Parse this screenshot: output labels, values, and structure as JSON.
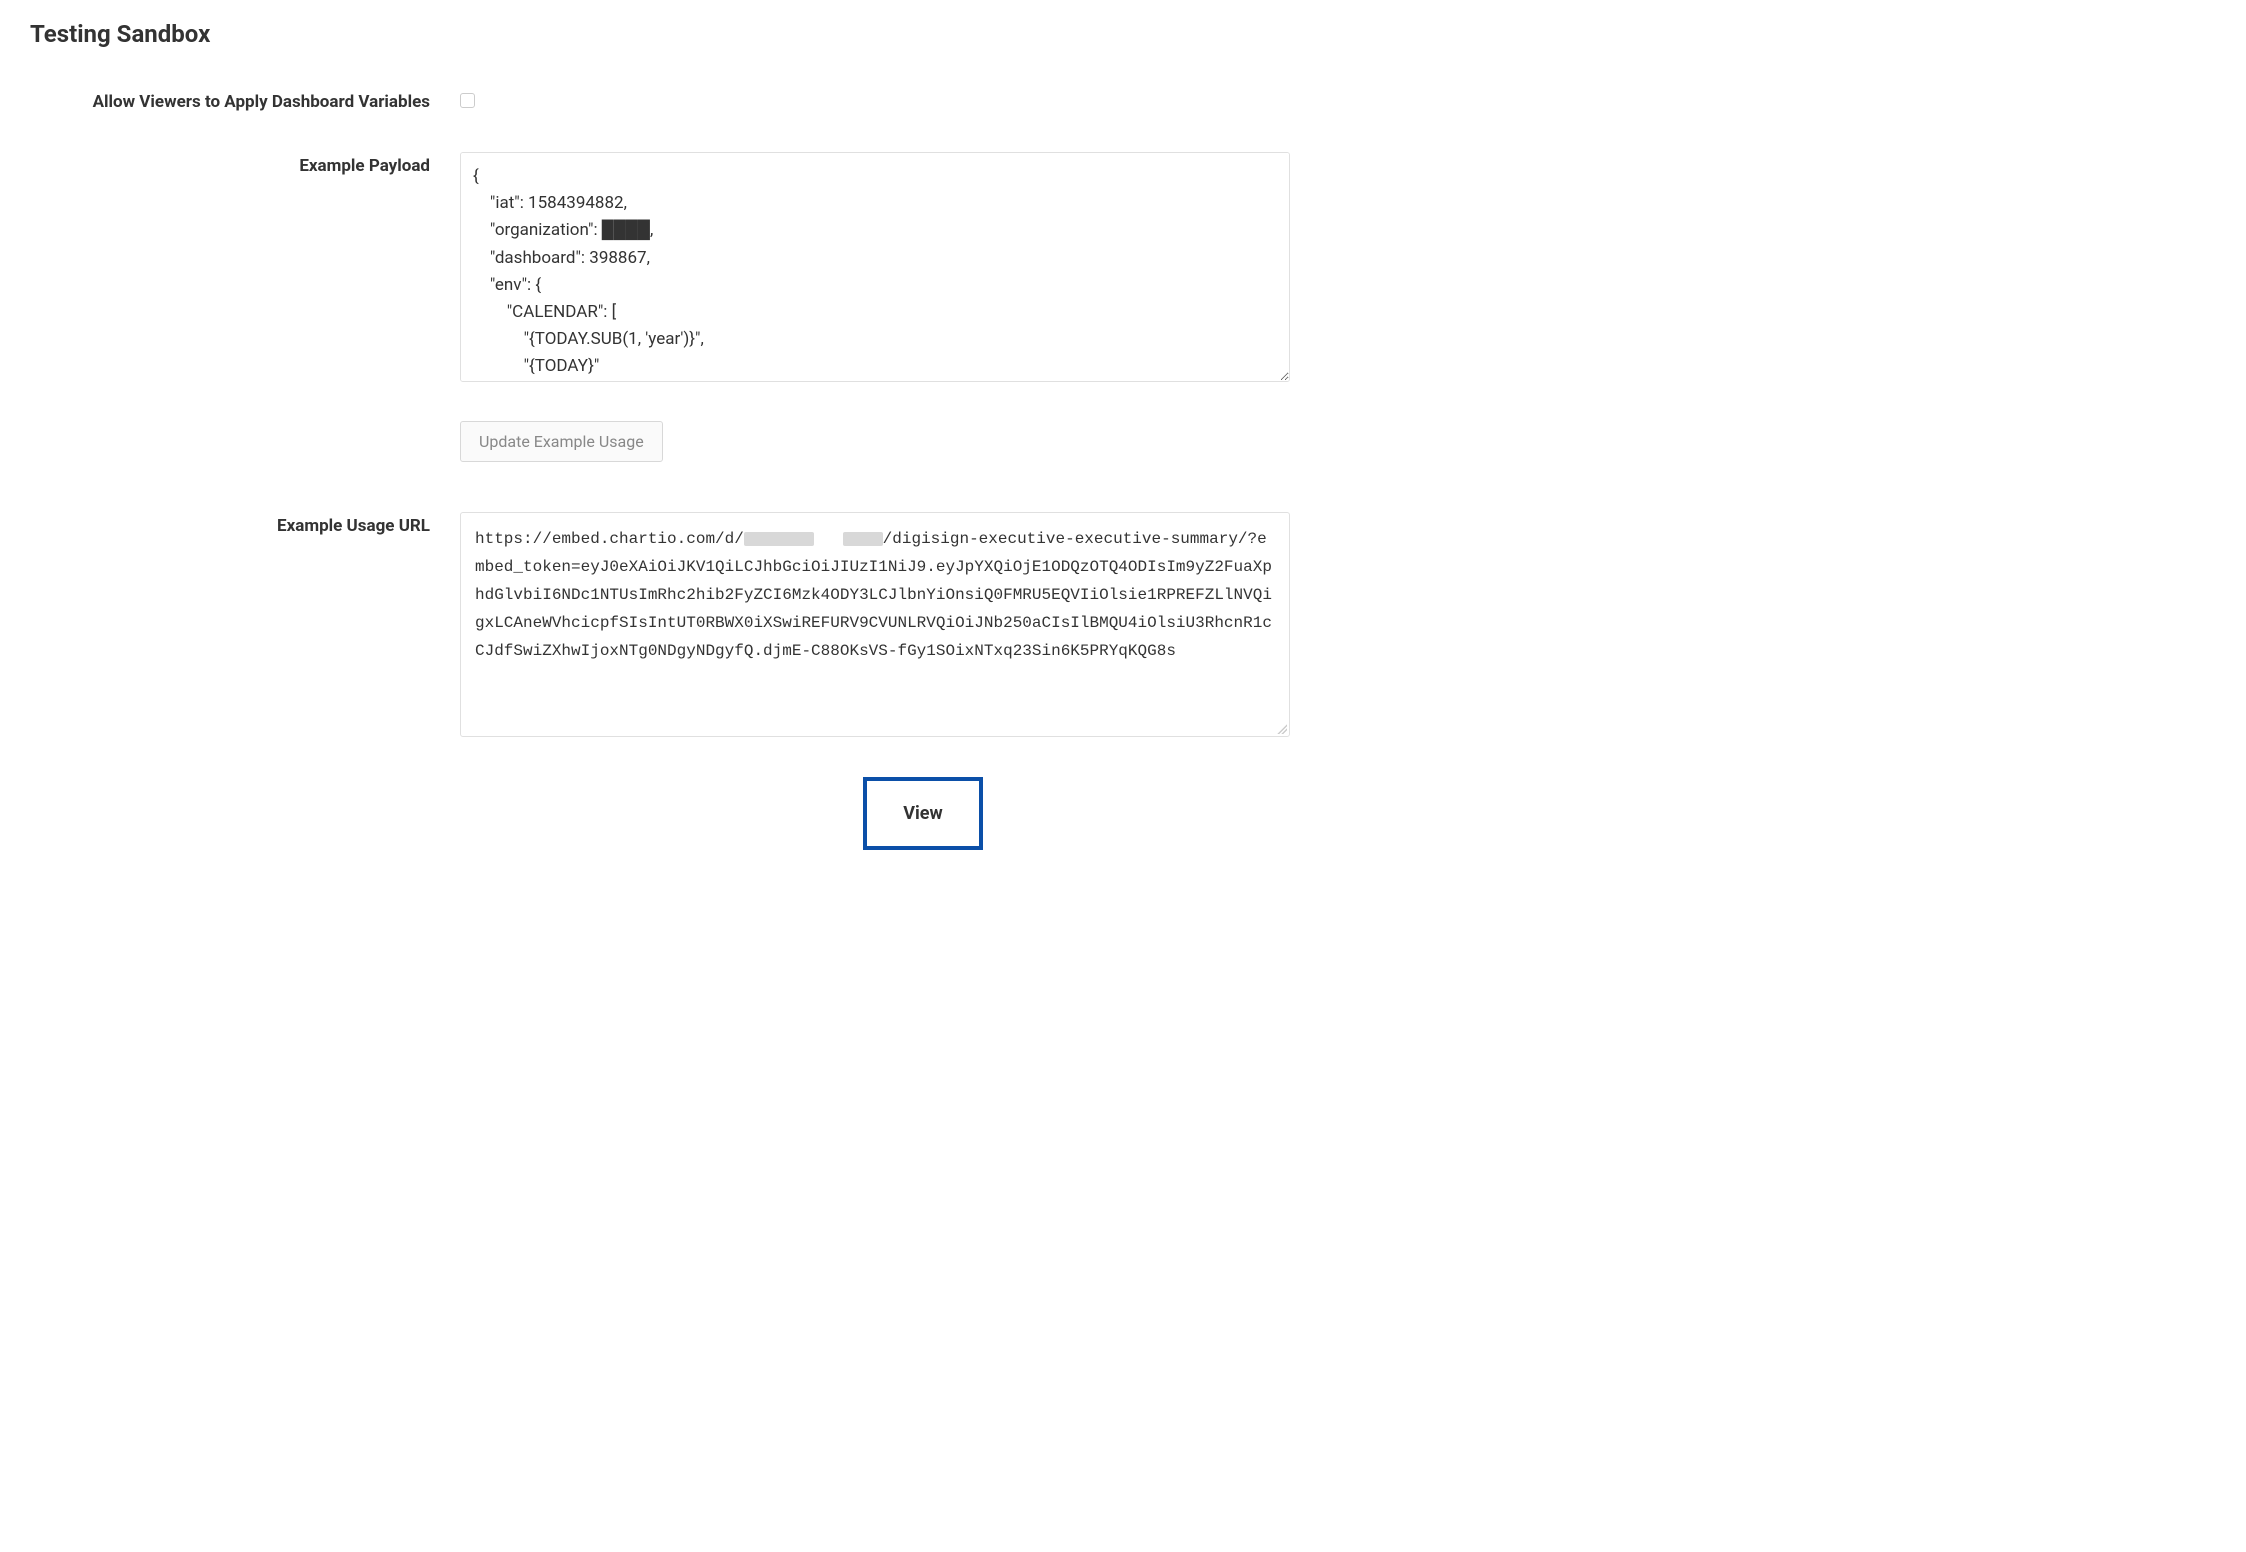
{
  "section_title": "Testing Sandbox",
  "allow_viewers_label": "Allow Viewers to Apply Dashboard Variables",
  "allow_viewers_checked": false,
  "example_payload_label": "Example Payload",
  "example_payload_value": "{\n    \"iat\": 1584394882,\n    \"organization\": ████,\n    \"dashboard\": 398867,\n    \"env\": {\n        \"CALENDAR\": [\n            \"{TODAY.SUB(1, 'year')}\",\n            \"{TODAY}\"",
  "update_example_usage_label": "Update Example Usage",
  "example_usage_url_label": "Example Usage URL",
  "example_usage_url": {
    "prefix": "https://embed.chartio.com/d/",
    "suffix": "/digisign-executive-executive-summary/?embed_token=eyJ0eXAiOiJKV1QiLCJhbGciOiJIUzI1NiJ9.eyJpYXQiOjE1ODQzOTQ4ODIsIm9yZ2FuaXphdGlvbiI6NDc1NTUsImRhc2hib2FyZCI6Mzk4ODY3LCJlbnYiOnsiQ0FMRU5EQVIiOlsie1RPREFZLlNVQigxLCAneWVhcicpfSIsIntUT0RBWX0iXSwiREFURV9CVUNLRVQiOiJNb250aCIsIlBMQU4iOlsiU3RhcnR1cCJdfSwiZXhwIjoxNTg0NDgyNDgyfQ.djmE-C88OKsVS-fGy1SOixNTxq23Sin6K5PRYqKQG8s"
  },
  "view_button_label": "View"
}
